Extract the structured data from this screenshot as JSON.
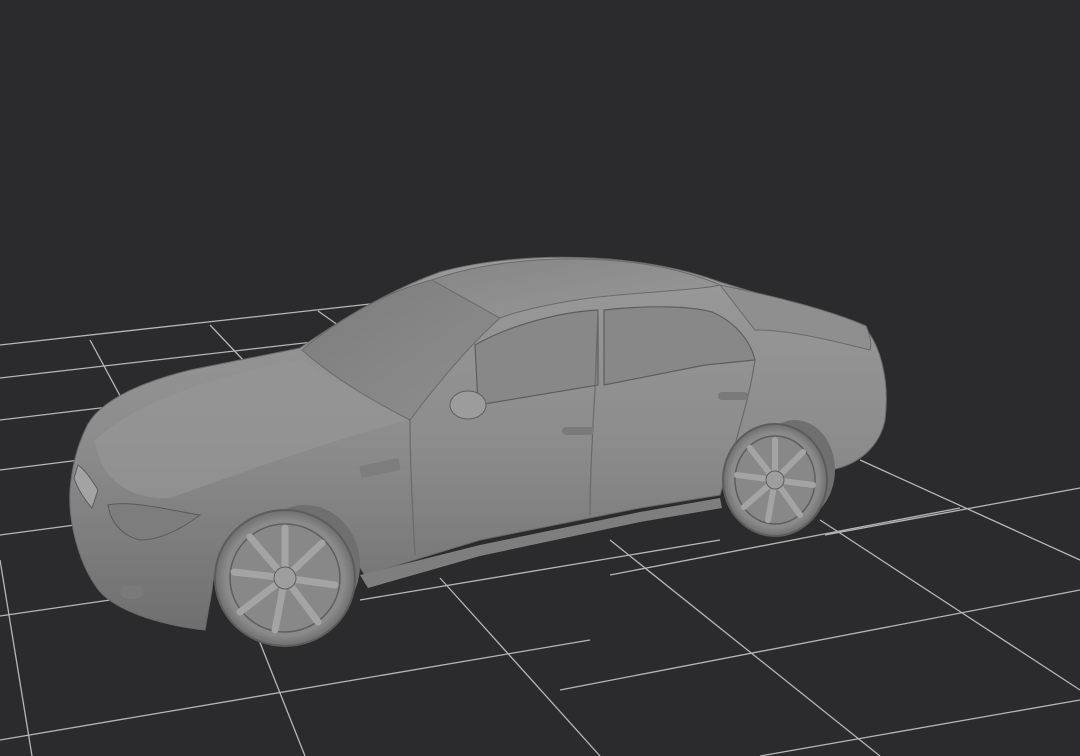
{
  "viewport": {
    "background_color": "#2b2a2d",
    "grid_color": "#c9c9c9",
    "model_color": "#8a8a8a",
    "model": "car-sedan",
    "grid": true
  }
}
